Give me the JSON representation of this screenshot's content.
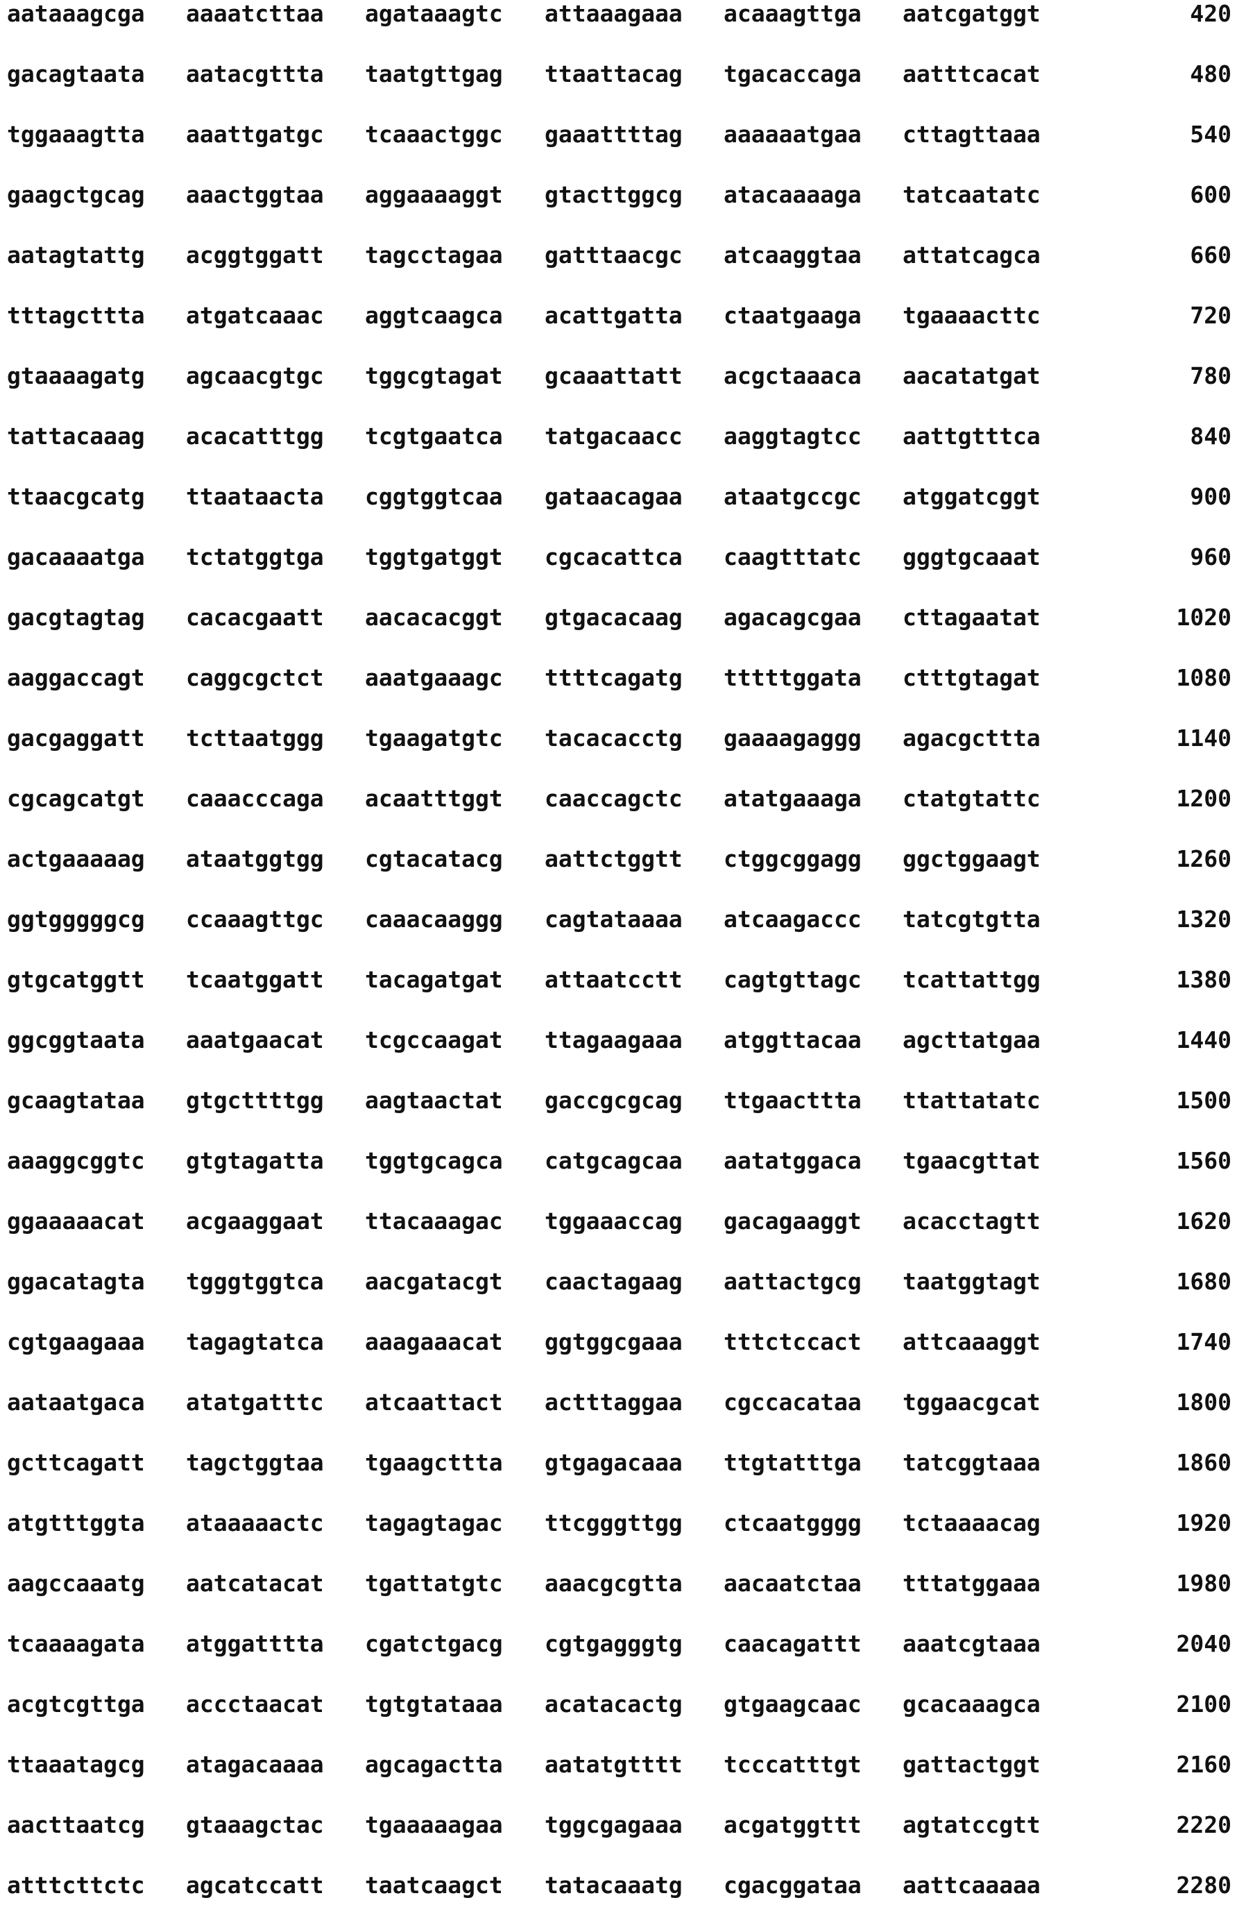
{
  "rows": [
    {
      "blocks": [
        "aataaagcga",
        "aaaatcttaa",
        "agataaagtc",
        "attaaagaaa",
        "acaaagttga",
        "aatcgatggt"
      ],
      "pos": "420"
    },
    {
      "blocks": [
        "gacagtaata",
        "aatacgttta",
        "taatgttgag",
        "ttaattacag",
        "tgacaccaga",
        "aatttcacat"
      ],
      "pos": "480"
    },
    {
      "blocks": [
        "tggaaagtta",
        "aaattgatgc",
        "tcaaactggc",
        "gaaattttag",
        "aaaaaatgaa",
        "cttagttaaa"
      ],
      "pos": "540"
    },
    {
      "blocks": [
        "gaagctgcag",
        "aaactggtaa",
        "aggaaaaggt",
        "gtacttggcg",
        "atacaaaaga",
        "tatcaatatc"
      ],
      "pos": "600"
    },
    {
      "blocks": [
        "aatagtattg",
        "acggtggatt",
        "tagcctagaa",
        "gatttaacgc",
        "atcaaggtaa",
        "attatcagca"
      ],
      "pos": "660"
    },
    {
      "blocks": [
        "tttagcttta",
        "atgatcaaac",
        "aggtcaagca",
        "acattgatta",
        "ctaatgaaga",
        "tgaaaacttc"
      ],
      "pos": "720"
    },
    {
      "blocks": [
        "gtaaaagatg",
        "agcaacgtgc",
        "tggcgtagat",
        "gcaaattatt",
        "acgctaaaca",
        "aacatatgat"
      ],
      "pos": "780"
    },
    {
      "blocks": [
        "tattacaaag",
        "acacatttgg",
        "tcgtgaatca",
        "tatgacaacc",
        "aaggtagtcc",
        "aattgtttca"
      ],
      "pos": "840"
    },
    {
      "blocks": [
        "ttaacgcatg",
        "ttaataacta",
        "cggtggtcaa",
        "gataacagaa",
        "ataatgccgc",
        "atggatcggt"
      ],
      "pos": "900"
    },
    {
      "blocks": [
        "gacaaaatga",
        "tctatggtga",
        "tggtgatggt",
        "cgcacattca",
        "caagtttatc",
        "gggtgcaaat"
      ],
      "pos": "960"
    },
    {
      "blocks": [
        "gacgtagtag",
        "cacacgaatt",
        "aacacacggt",
        "gtgacacaag",
        "agacagcgaa",
        "cttagaatat"
      ],
      "pos": "1020"
    },
    {
      "blocks": [
        "aaggaccagt",
        "caggcgctct",
        "aaatgaaagc",
        "ttttcagatg",
        "tttttggata",
        "ctttgtagat"
      ],
      "pos": "1080"
    },
    {
      "blocks": [
        "gacgaggatt",
        "tcttaatggg",
        "tgaagatgtc",
        "tacacacctg",
        "gaaaagaggg",
        "agacgcttta"
      ],
      "pos": "1140"
    },
    {
      "blocks": [
        "cgcagcatgt",
        "caaacccaga",
        "acaatttggt",
        "caaccagctc",
        "atatgaaaga",
        "ctatgtattc"
      ],
      "pos": "1200"
    },
    {
      "blocks": [
        "actgaaaaag",
        "ataatggtgg",
        "cgtacatacg",
        "aattctggtt",
        "ctggcggagg",
        "ggctggaagt"
      ],
      "pos": "1260"
    },
    {
      "blocks": [
        "ggtgggggcg",
        "ccaaagttgc",
        "caaacaaggg",
        "cagtataaaa",
        "atcaagaccc",
        "tatcgtgtta"
      ],
      "pos": "1320"
    },
    {
      "blocks": [
        "gtgcatggtt",
        "tcaatggatt",
        "tacagatgat",
        "attaatcctt",
        "cagtgttagc",
        "tcattattgg"
      ],
      "pos": "1380"
    },
    {
      "blocks": [
        "ggcggtaata",
        "aaatgaacat",
        "tcgccaagat",
        "ttagaagaaa",
        "atggttacaa",
        "agcttatgaa"
      ],
      "pos": "1440"
    },
    {
      "blocks": [
        "gcaagtataa",
        "gtgcttttgg",
        "aagtaactat",
        "gaccgcgcag",
        "ttgaacttta",
        "ttattatatc"
      ],
      "pos": "1500"
    },
    {
      "blocks": [
        "aaaggcggtc",
        "gtgtagatta",
        "tggtgcagca",
        "catgcagcaa",
        "aatatggaca",
        "tgaacgttat"
      ],
      "pos": "1560"
    },
    {
      "blocks": [
        "ggaaaaacat",
        "acgaaggaat",
        "ttacaaagac",
        "tggaaaccag",
        "gacagaaggt",
        "acacctagtt"
      ],
      "pos": "1620"
    },
    {
      "blocks": [
        "ggacatagta",
        "tgggtggtca",
        "aacgatacgt",
        "caactagaag",
        "aattactgcg",
        "taatggtagt"
      ],
      "pos": "1680"
    },
    {
      "blocks": [
        "cgtgaagaaa",
        "tagagtatca",
        "aaagaaacat",
        "ggtggcgaaa",
        "tttctccact",
        "attcaaaggt"
      ],
      "pos": "1740"
    },
    {
      "blocks": [
        "aataatgaca",
        "atatgatttc",
        "atcaattact",
        "actttaggaa",
        "cgccacataa",
        "tggaacgcat"
      ],
      "pos": "1800"
    },
    {
      "blocks": [
        "gcttcagatt",
        "tagctggtaa",
        "tgaagcttta",
        "gtgagacaaa",
        "ttgtatttga",
        "tatcggtaaa"
      ],
      "pos": "1860"
    },
    {
      "blocks": [
        "atgtttggta",
        "ataaaaactc",
        "tagagtagac",
        "ttcgggttgg",
        "ctcaatgggg",
        "tctaaaacag"
      ],
      "pos": "1920"
    },
    {
      "blocks": [
        "aagccaaatg",
        "aatcatacat",
        "tgattatgtc",
        "aaacgcgtta",
        "aacaatctaa",
        "tttatggaaa"
      ],
      "pos": "1980"
    },
    {
      "blocks": [
        "tcaaaagata",
        "atggatttta",
        "cgatctgacg",
        "cgtgagggtg",
        "caacagattt",
        "aaatcgtaaa"
      ],
      "pos": "2040"
    },
    {
      "blocks": [
        "acgtcgttga",
        "accctaacat",
        "tgtgtataaa",
        "acatacactg",
        "gtgaagcaac",
        "gcacaaagca"
      ],
      "pos": "2100"
    },
    {
      "blocks": [
        "ttaaatagcg",
        "atagacaaaa",
        "agcagactta",
        "aatatgtttt",
        "tcccatttgt",
        "gattactggt"
      ],
      "pos": "2160"
    },
    {
      "blocks": [
        "aacttaatcg",
        "gtaaagctac",
        "tgaaaaagaa",
        "tggcgagaaa",
        "acgatggttt",
        "agtatccgtt"
      ],
      "pos": "2220"
    },
    {
      "blocks": [
        "atttcttctc",
        "agcatccatt",
        "taatcaagct",
        "tatacaaatg",
        "cgacggataa",
        "aattcaaaaa"
      ],
      "pos": "2280"
    }
  ]
}
